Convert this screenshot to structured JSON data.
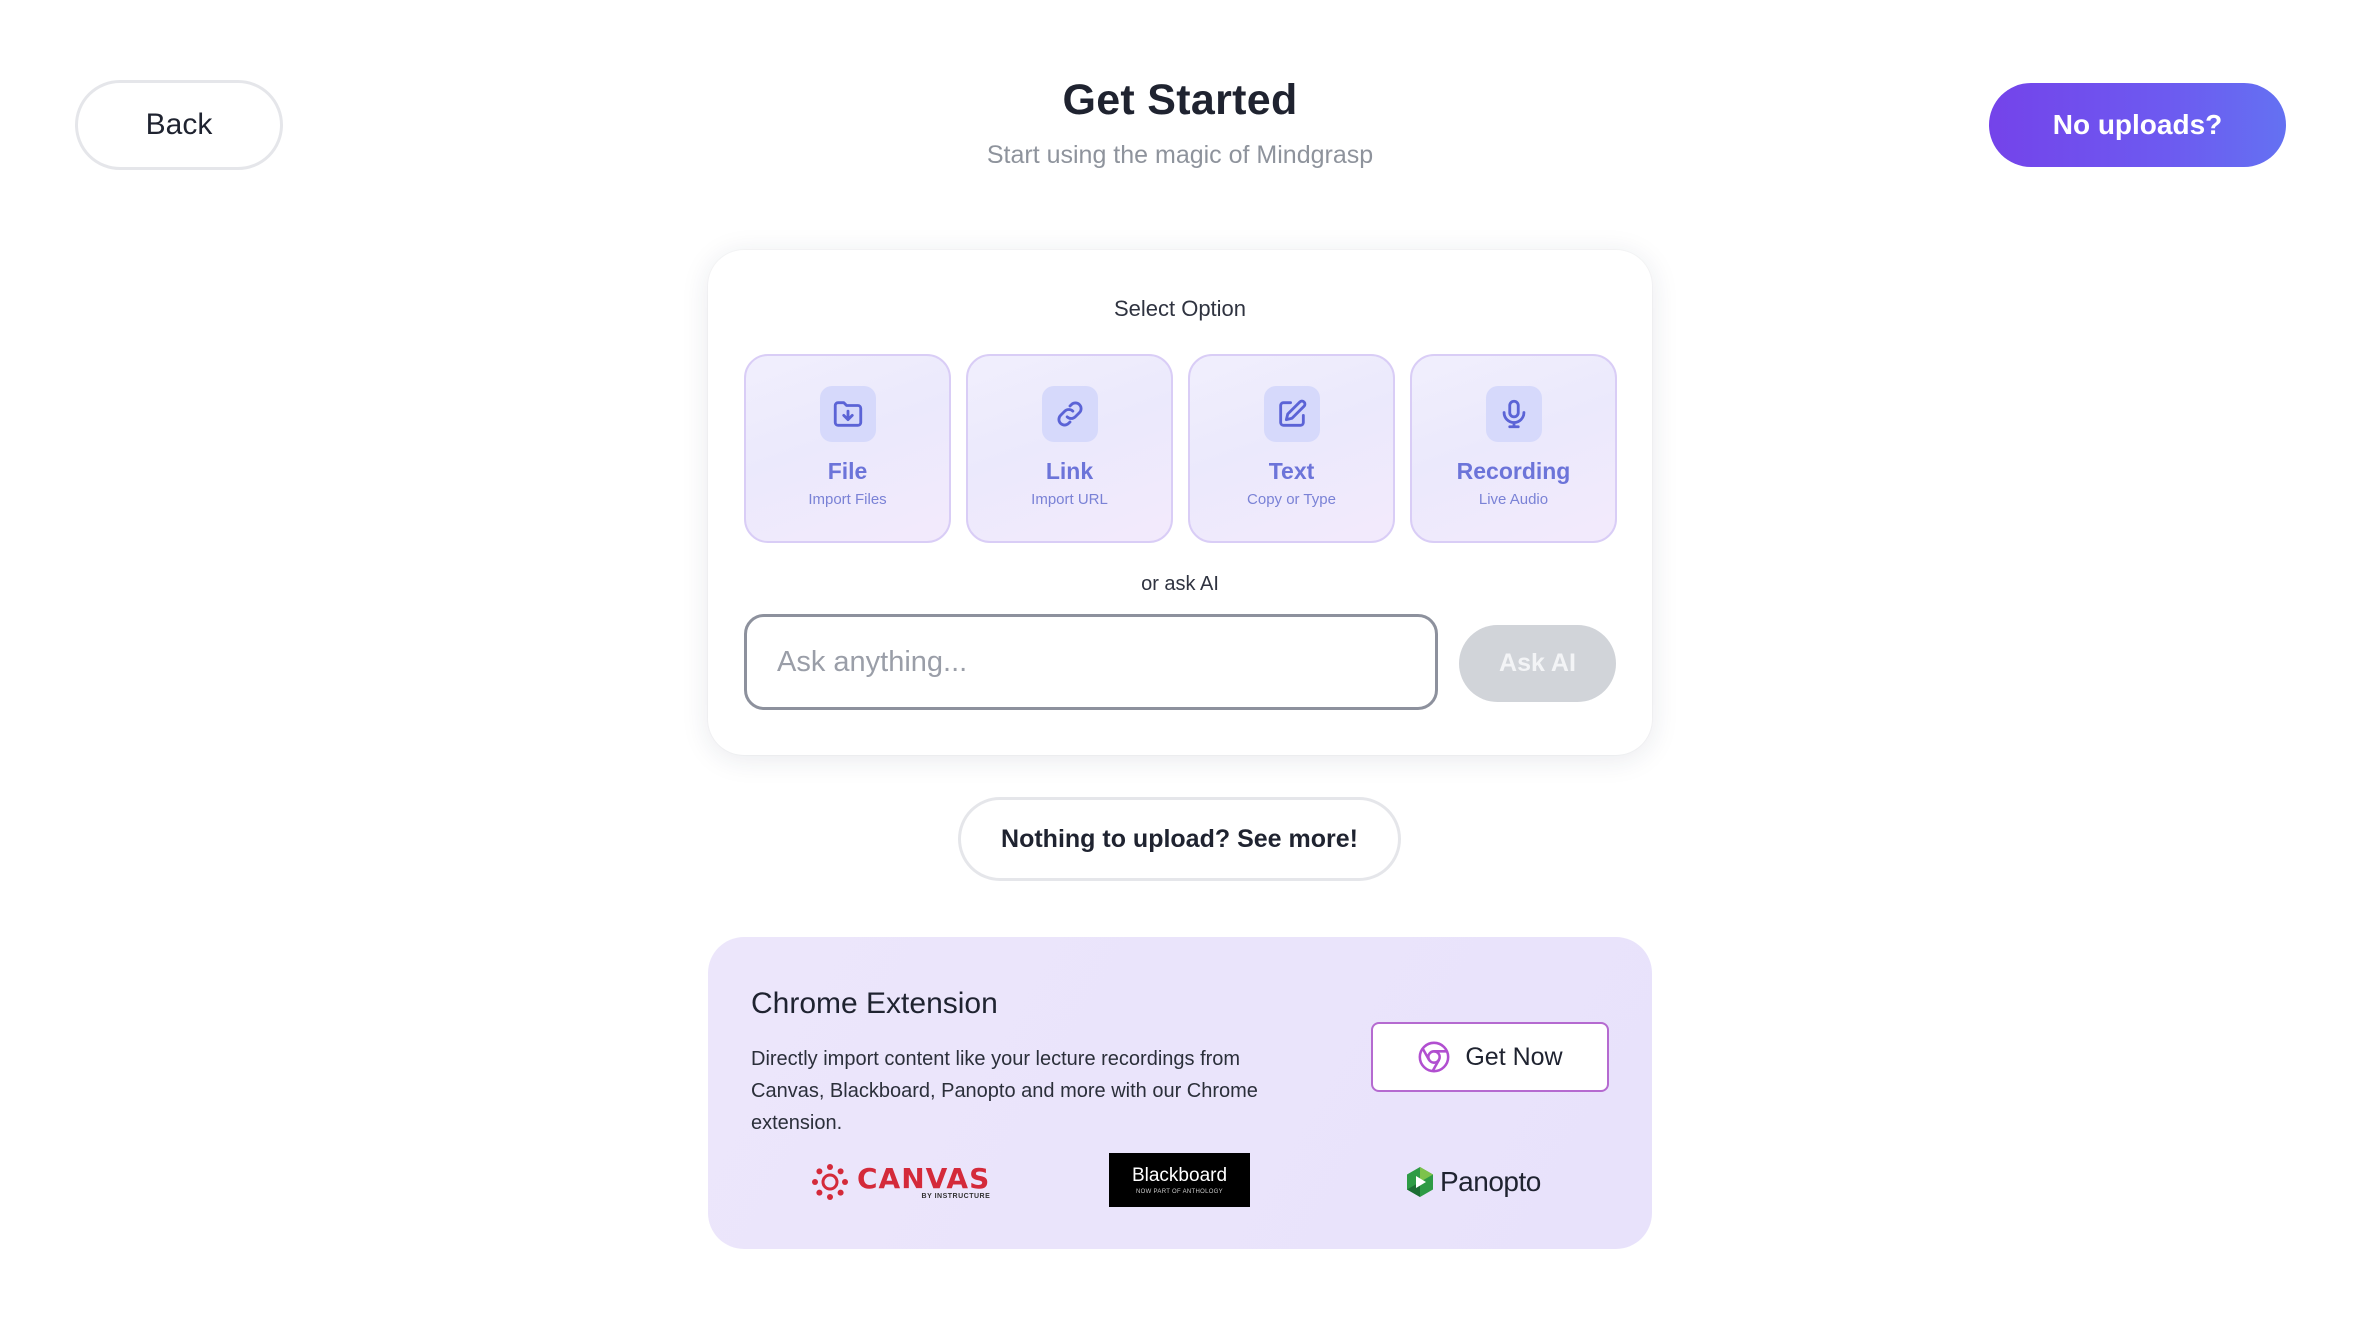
{
  "header": {
    "back_label": "Back",
    "title": "Get Started",
    "subtitle": "Start using the magic of Mindgrasp",
    "no_uploads_label": "No uploads?"
  },
  "main_card": {
    "select_label": "Select Option",
    "options": [
      {
        "icon": "folder-download-icon",
        "title": "File",
        "subtitle": "Import Files"
      },
      {
        "icon": "link-icon",
        "title": "Link",
        "subtitle": "Import URL"
      },
      {
        "icon": "edit-icon",
        "title": "Text",
        "subtitle": "Copy or Type"
      },
      {
        "icon": "microphone-icon",
        "title": "Recording",
        "subtitle": "Live Audio"
      }
    ],
    "ask_label": "or ask AI",
    "ask_placeholder": "Ask anything...",
    "ask_value": "",
    "ask_button_label": "Ask AI"
  },
  "see_more_label": "Nothing to upload? See more!",
  "extension": {
    "title": "Chrome Extension",
    "description": "Directly import content like your lecture recordings from Canvas, Blackboard, Panopto and more with our Chrome extension.",
    "button_label": "Get Now",
    "button_icon": "chrome-icon",
    "logos": {
      "canvas": {
        "name": "CANVAS",
        "tagline": "BY INSTRUCTURE"
      },
      "blackboard": {
        "name": "Blackboard",
        "tagline": "NOW PART OF ANTHOLOGY"
      },
      "panopto": {
        "name": "Panopto"
      }
    }
  },
  "colors": {
    "accent_gradient_start": "#7443ea",
    "accent_gradient_end": "#6471f2",
    "option_text": "#6c74d9",
    "extension_bg": "#ebe5fb",
    "canvas_red": "#d42a3a"
  }
}
